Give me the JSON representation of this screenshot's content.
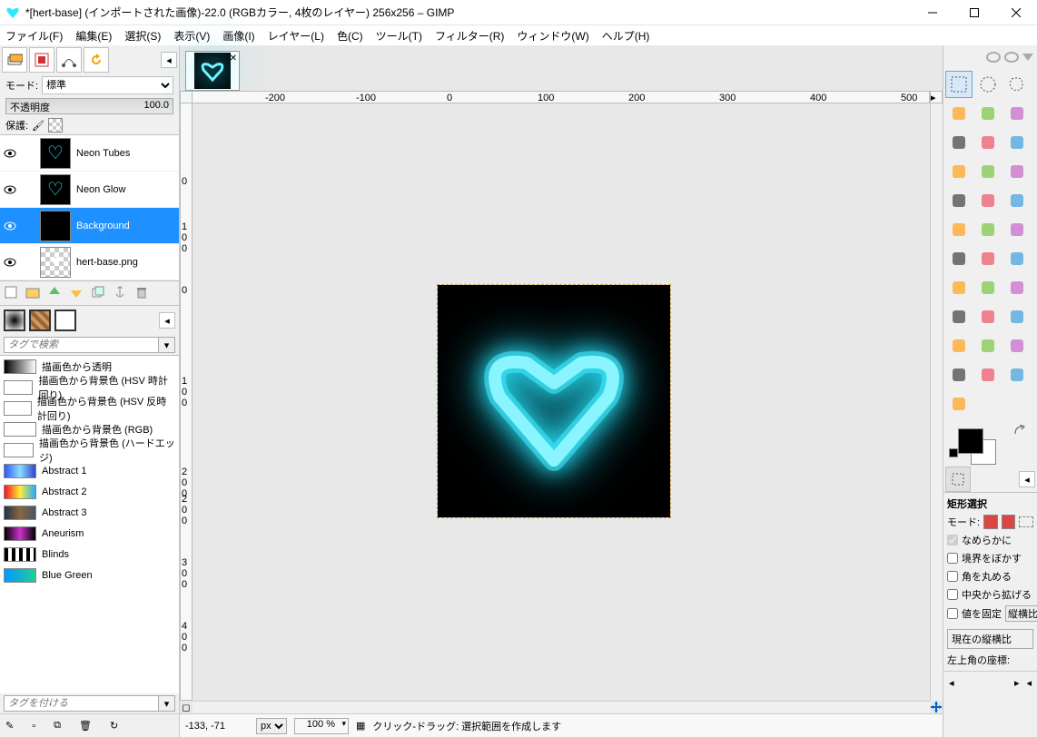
{
  "window": {
    "title": "*[hert-base] (インポートされた画像)-22.0 (RGBカラー, 4枚のレイヤー) 256x256 – GIMP"
  },
  "menubar": {
    "file": "ファイル(F)",
    "edit": "編集(E)",
    "select": "選択(S)",
    "view": "表示(V)",
    "image": "画像(I)",
    "layer": "レイヤー(L)",
    "color": "色(C)",
    "tools": "ツール(T)",
    "filters": "フィルター(R)",
    "windows": "ウィンドウ(W)",
    "help": "ヘルプ(H)"
  },
  "layers_panel": {
    "mode_label": "モード:",
    "mode_value": "標準",
    "opacity_label": "不透明度",
    "opacity_value": "100.0",
    "protect_label": "保護:"
  },
  "layers": [
    {
      "name": "Neon Tubes",
      "selected": false,
      "thumb": "heart-cyan"
    },
    {
      "name": "Neon Glow",
      "selected": false,
      "thumb": "heart-glow"
    },
    {
      "name": "Background",
      "selected": true,
      "thumb": "black"
    },
    {
      "name": "hert-base.png",
      "selected": false,
      "thumb": "heart-white"
    }
  ],
  "gradients": {
    "search_placeholder": "タグで検索",
    "tag_placeholder": "タグを付ける",
    "items": [
      {
        "name": "描画色から透明",
        "grad": "linear-gradient(90deg,#000,transparent)"
      },
      {
        "name": "描画色から背景色 (HSV 時計回り)",
        "grad": "linear-gradient(90deg,#fff,#fff)"
      },
      {
        "name": "描画色から背景色 (HSV 反時計回り)",
        "grad": "linear-gradient(90deg,#fff,#fff)"
      },
      {
        "name": "描画色から背景色 (RGB)",
        "grad": "linear-gradient(90deg,#fff,#fff)"
      },
      {
        "name": "描画色から背景色 (ハードエッジ)",
        "grad": "linear-gradient(90deg,#fff,#fff)"
      },
      {
        "name": "Abstract 1",
        "grad": "linear-gradient(90deg,#3355ff,#88ddff,#3344cc)"
      },
      {
        "name": "Abstract 2",
        "grad": "linear-gradient(90deg,#ff1122,#ffee33,#22aaff)"
      },
      {
        "name": "Abstract 3",
        "grad": "linear-gradient(90deg,#223344,#886644,#445566)"
      },
      {
        "name": "Aneurism",
        "grad": "linear-gradient(90deg,#000,#cc33cc,#000)"
      },
      {
        "name": "Blinds",
        "grad": "repeating-linear-gradient(90deg,#000 0 4px,#fff 4px 8px)"
      },
      {
        "name": "Blue Green",
        "grad": "linear-gradient(90deg,#0099ff,#22cc99)"
      }
    ]
  },
  "ruler_h_marks": [
    {
      "label": "-200",
      "pos": 80
    },
    {
      "label": "-100",
      "pos": 180
    },
    {
      "label": "0",
      "pos": 280
    },
    {
      "label": "100",
      "pos": 380
    },
    {
      "label": "200",
      "pos": 480
    },
    {
      "label": "300",
      "pos": 580
    },
    {
      "label": "400",
      "pos": 680
    },
    {
      "label": "500",
      "pos": 780
    }
  ],
  "ruler_v_marks": [
    {
      "label": "0",
      "pos": 80
    },
    {
      "label": "1\n0\n0",
      "pos": 130
    },
    {
      "label": "0",
      "pos": 200
    },
    {
      "label": "1\n0\n0",
      "pos": 300
    },
    {
      "label": "2\n0\n0",
      "pos": 400
    },
    {
      "label": "2\n0\n0",
      "pos": 430
    },
    {
      "label": "3\n0\n0",
      "pos": 500
    },
    {
      "label": "4\n0\n0",
      "pos": 570
    }
  ],
  "status": {
    "coord": "-133, -71",
    "unit": "px",
    "zoom": "100 %",
    "hint": "クリック-ドラッグ: 選択範囲を作成します"
  },
  "tool_options": {
    "title": "矩形選択",
    "mode_label": "モード:",
    "smooth": "なめらかに",
    "feather": "境界をぼかす",
    "round": "角を丸める",
    "expand": "中央から拡げる",
    "fixed": "値を固定",
    "aspect": "縦横比",
    "current": "現在の縦横比",
    "pos_label": "左上角の座標:"
  },
  "tool_icons": [
    "rect-select",
    "ellipse-select",
    "free-select",
    "scissors",
    "fg-select",
    "fuzzy-select",
    "color-select",
    "crop",
    "path",
    "zoom",
    "measure",
    "move",
    "align",
    "rotate",
    "scale",
    "shear",
    "perspective",
    "flip",
    "cage",
    "warp",
    "text",
    "bucket",
    "blend",
    "pencil",
    "brush",
    "eraser",
    "airbrush",
    "ink",
    "clone",
    "heal",
    "smudge",
    "blur",
    "dodge",
    "mypaint"
  ]
}
